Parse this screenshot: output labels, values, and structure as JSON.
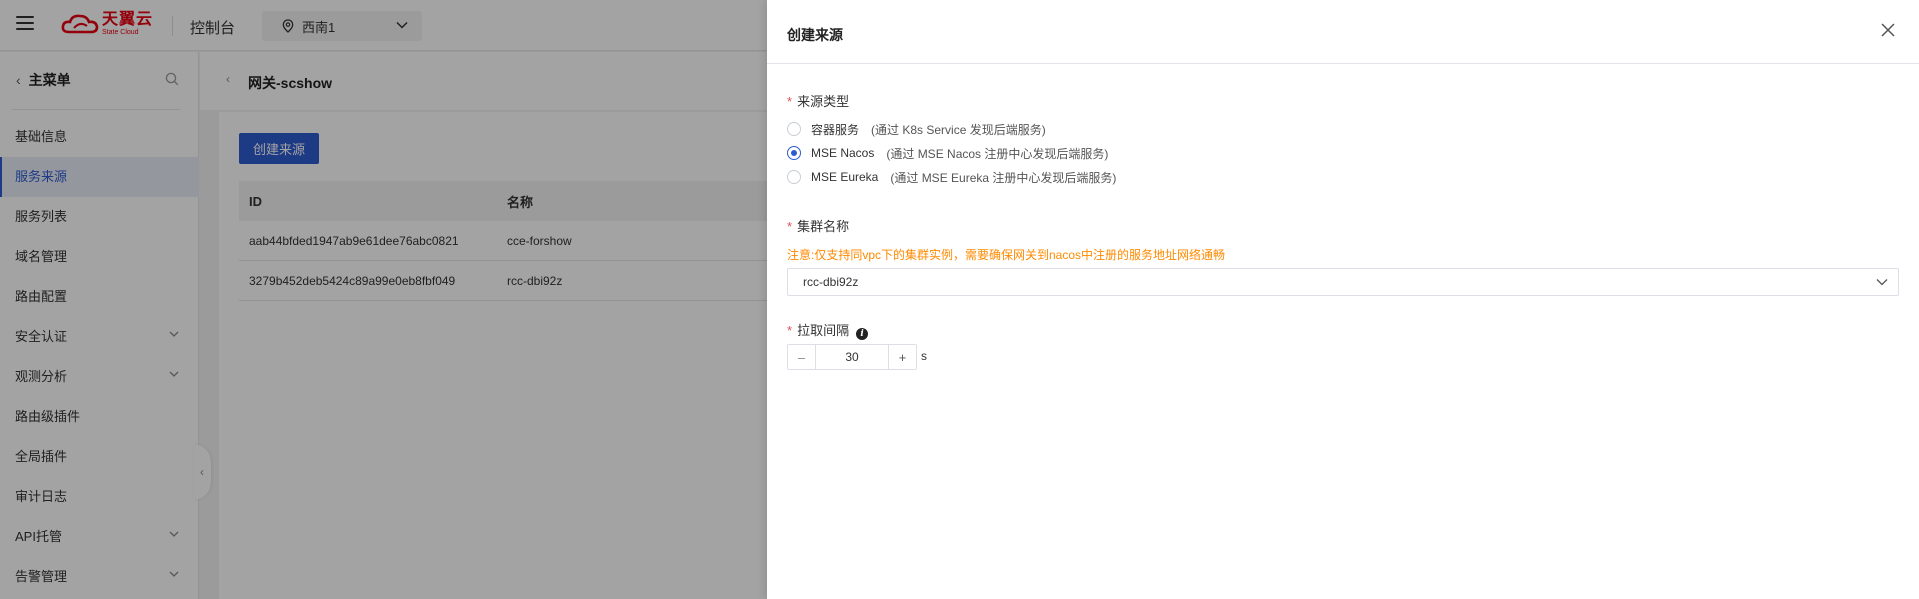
{
  "topbar": {
    "logo_cn": "天翼云",
    "logo_en": "State Cloud",
    "console_label": "控制台",
    "region": "西南1"
  },
  "sidebar": {
    "menu_title": "主菜单",
    "items": [
      {
        "label": "基础信息"
      },
      {
        "label": "服务来源"
      },
      {
        "label": "服务列表"
      },
      {
        "label": "域名管理"
      },
      {
        "label": "路由配置"
      },
      {
        "label": "安全认证"
      },
      {
        "label": "观测分析"
      },
      {
        "label": "路由级插件"
      },
      {
        "label": "全局插件"
      },
      {
        "label": "审计日志"
      },
      {
        "label": "API托管"
      },
      {
        "label": "告警管理"
      }
    ]
  },
  "main": {
    "title": "网关-scshow",
    "create_button": "创建来源",
    "table": {
      "columns": [
        "ID",
        "名称"
      ],
      "rows": [
        [
          "aab44bfded1947ab9e61dee76abc0821",
          "cce-forshow"
        ],
        [
          "3279b452deb5424c89a99e0eb8fbf049",
          "rcc-dbi92z"
        ]
      ]
    }
  },
  "drawer": {
    "title": "创建来源",
    "source_type_label": "来源类型",
    "source_options": [
      {
        "label": "容器服务",
        "desc": "(通过 K8s Service 发现后端服务)",
        "checked": false
      },
      {
        "label": "MSE Nacos",
        "desc": "(通过 MSE Nacos 注册中心发现后端服务)",
        "checked": true
      },
      {
        "label": "MSE Eureka",
        "desc": "(通过 MSE Eureka 注册中心发现后端服务)",
        "checked": false
      }
    ],
    "cluster_label": "集群名称",
    "cluster_warning": "注意:仅支持同vpc下的集群实例，需要确保网关到nacos中注册的服务地址网络通畅",
    "cluster_value": "rcc-dbi92z",
    "interval_label": "拉取间隔",
    "interval_value": "30",
    "interval_unit": "s"
  }
}
